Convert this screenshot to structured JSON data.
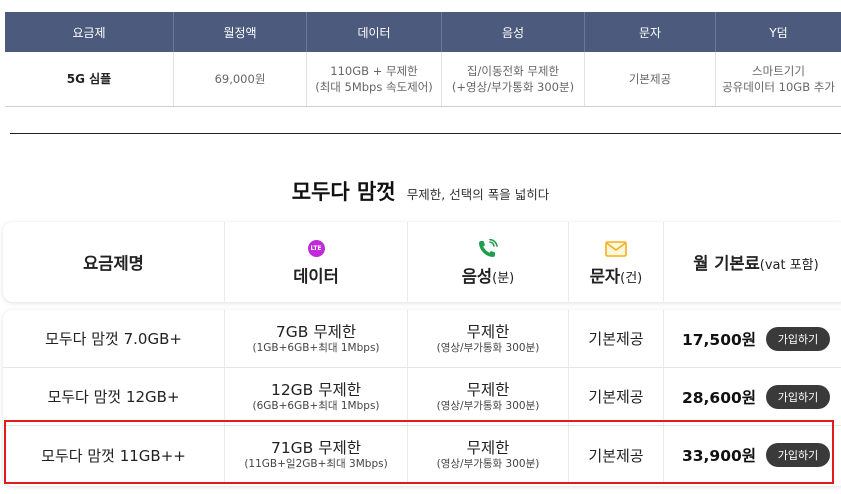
{
  "top_table": {
    "headers": [
      "요금제",
      "월정액",
      "데이터",
      "음성",
      "문자",
      "Y덤"
    ],
    "row": {
      "plan": "5G 심플",
      "price": "69,000원",
      "data_line1": "110GB + 무제한",
      "data_line2": "(최대 5Mbps 속도제어)",
      "voice_line1": "집/이동전화 무제한",
      "voice_line2": "(+영상/부가통화 300분)",
      "sms": "기본제공",
      "ydum_line1": "스마트기기",
      "ydum_line2": "공유데이터 10GB 추가"
    },
    "header_color": "#4c5b7d"
  },
  "title": {
    "main": "모두다 맘껏",
    "sub": "무제한, 선택의 폭을 넓히다"
  },
  "plan_table": {
    "headers": {
      "name": "요금제명",
      "data": "데이터",
      "voice": "음성",
      "voice_unit": "(분)",
      "sms": "문자",
      "sms_unit": "(건)",
      "fee": "월 기본료",
      "fee_unit": "(vat 포함)"
    },
    "icons": {
      "data": "lte-icon",
      "voice": "phone-icon",
      "sms": "envelope-icon"
    },
    "lte_text": "LTE",
    "rows": [
      {
        "name": "모두다 맘껏 7.0GB+",
        "data_main": "7GB 무제한",
        "data_sub": "(1GB+6GB+최대 1Mbps)",
        "voice_main": "무제한",
        "voice_sub": "(영상/부가통화 300분)",
        "sms": "기본제공",
        "price": "17,500원",
        "button": "가입하기"
      },
      {
        "name": "모두다 맘껏 12GB+",
        "data_main": "12GB 무제한",
        "data_sub": "(6GB+6GB+최대 1Mbps)",
        "voice_main": "무제한",
        "voice_sub": "(영상/부가통화 300분)",
        "sms": "기본제공",
        "price": "28,600원",
        "button": "가입하기"
      },
      {
        "name": "모두다 맘껏 11GB++",
        "data_main": "71GB 무제한",
        "data_sub": "(11GB+일2GB+최대 3Mbps)",
        "voice_main": "무제한",
        "voice_sub": "(영상/부가통화 300분)",
        "sms": "기본제공",
        "price": "33,900원",
        "button": "가입하기"
      }
    ],
    "colors": {
      "lte": "#c02ad8",
      "phone": "#1e9e4a",
      "envelope": "#f2b11c",
      "button": "#3a3a3a",
      "highlight": "#e31b1b"
    }
  }
}
